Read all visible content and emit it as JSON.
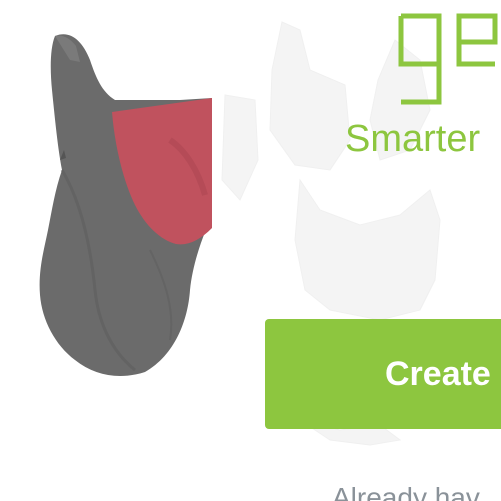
{
  "branding": {
    "logo_text": "ge",
    "tagline": "Smarter",
    "accent_color": "#8dc63f"
  },
  "hero": {
    "image_icon": "face-mask-product-image"
  },
  "cta": {
    "create_label": "Create"
  },
  "footer": {
    "signin_text": "Already hav"
  },
  "colors": {
    "mask_body": "#6b6b6b",
    "mask_lining": "#c0525e",
    "muted_text": "#8a9299"
  }
}
